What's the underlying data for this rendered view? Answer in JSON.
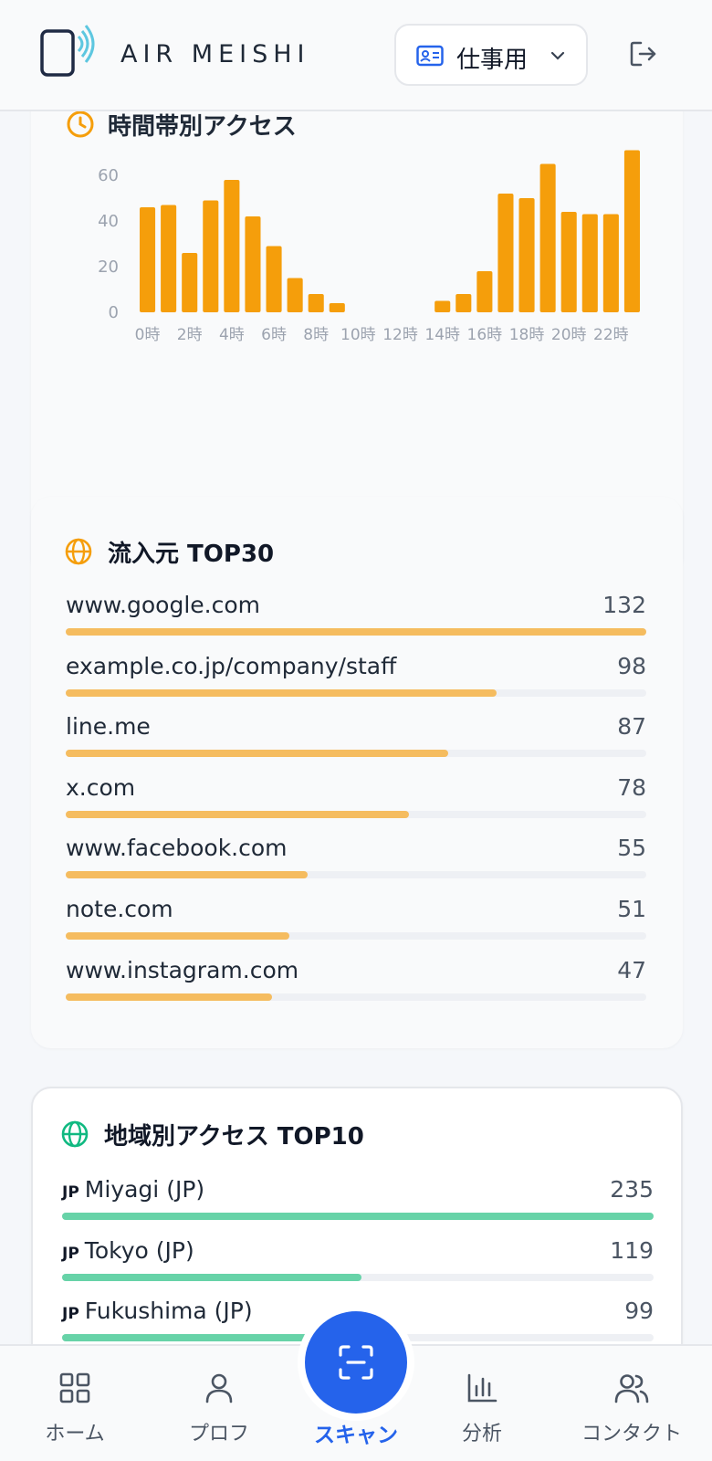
{
  "header": {
    "brand": "AIR MEISHI",
    "profile_select": {
      "selected": "仕事用"
    }
  },
  "hourly_card": {
    "title": "時間帯別アクセス"
  },
  "chart_data": {
    "type": "bar",
    "title": "時間帯別アクセス",
    "categories": [
      "0時",
      "1時",
      "2時",
      "3時",
      "4時",
      "5時",
      "6時",
      "7時",
      "8時",
      "9時",
      "10時",
      "11時",
      "12時",
      "13時",
      "14時",
      "15時",
      "16時",
      "17時",
      "18時",
      "19時",
      "20時",
      "21時",
      "22時",
      "23時"
    ],
    "values": [
      46,
      47,
      26,
      49,
      58,
      42,
      29,
      15,
      8,
      4,
      0,
      0,
      0,
      0,
      5,
      8,
      18,
      52,
      50,
      65,
      44,
      43,
      43,
      71
    ],
    "tick_labels": [
      "0時",
      "2時",
      "4時",
      "6時",
      "8時",
      "10時",
      "12時",
      "14時",
      "16時",
      "18時",
      "20時",
      "22時"
    ],
    "yticks": [
      "0",
      "20",
      "40",
      "60",
      "80"
    ],
    "ylim": [
      0,
      80
    ],
    "color": "#f59e0b",
    "grid": false
  },
  "sources_card": {
    "title": "流入元 TOP30",
    "items": [
      {
        "label": "www.google.com",
        "value": "132",
        "ratio": 1.0
      },
      {
        "label": "example.co.jp/company/staff",
        "value": "98",
        "ratio": 0.742
      },
      {
        "label": "line.me",
        "value": "87",
        "ratio": 0.659
      },
      {
        "label": "x.com",
        "value": "78",
        "ratio": 0.591
      },
      {
        "label": "www.facebook.com",
        "value": "55",
        "ratio": 0.417
      },
      {
        "label": "note.com",
        "value": "51",
        "ratio": 0.386
      },
      {
        "label": "www.instagram.com",
        "value": "47",
        "ratio": 0.356
      }
    ]
  },
  "region_card": {
    "title": "地域別アクセス TOP10",
    "items": [
      {
        "cc": "JP",
        "label": "Miyagi (JP)",
        "value": "235",
        "ratio": 1.0
      },
      {
        "cc": "JP",
        "label": "Tokyo (JP)",
        "value": "119",
        "ratio": 0.506
      },
      {
        "cc": "JP",
        "label": "Fukushima (JP)",
        "value": "99",
        "ratio": 0.421
      }
    ]
  },
  "bottom_nav": {
    "home": "ホーム",
    "profile": "プロフ",
    "scan": "スキャン",
    "analytics": "分析",
    "contacts": "コンタクト"
  },
  "colors": {
    "accent": "#2563eb",
    "chart_bar": "#f59e0b",
    "source_bar": "#f5bc5f",
    "region_bar": "#67d3a8"
  }
}
